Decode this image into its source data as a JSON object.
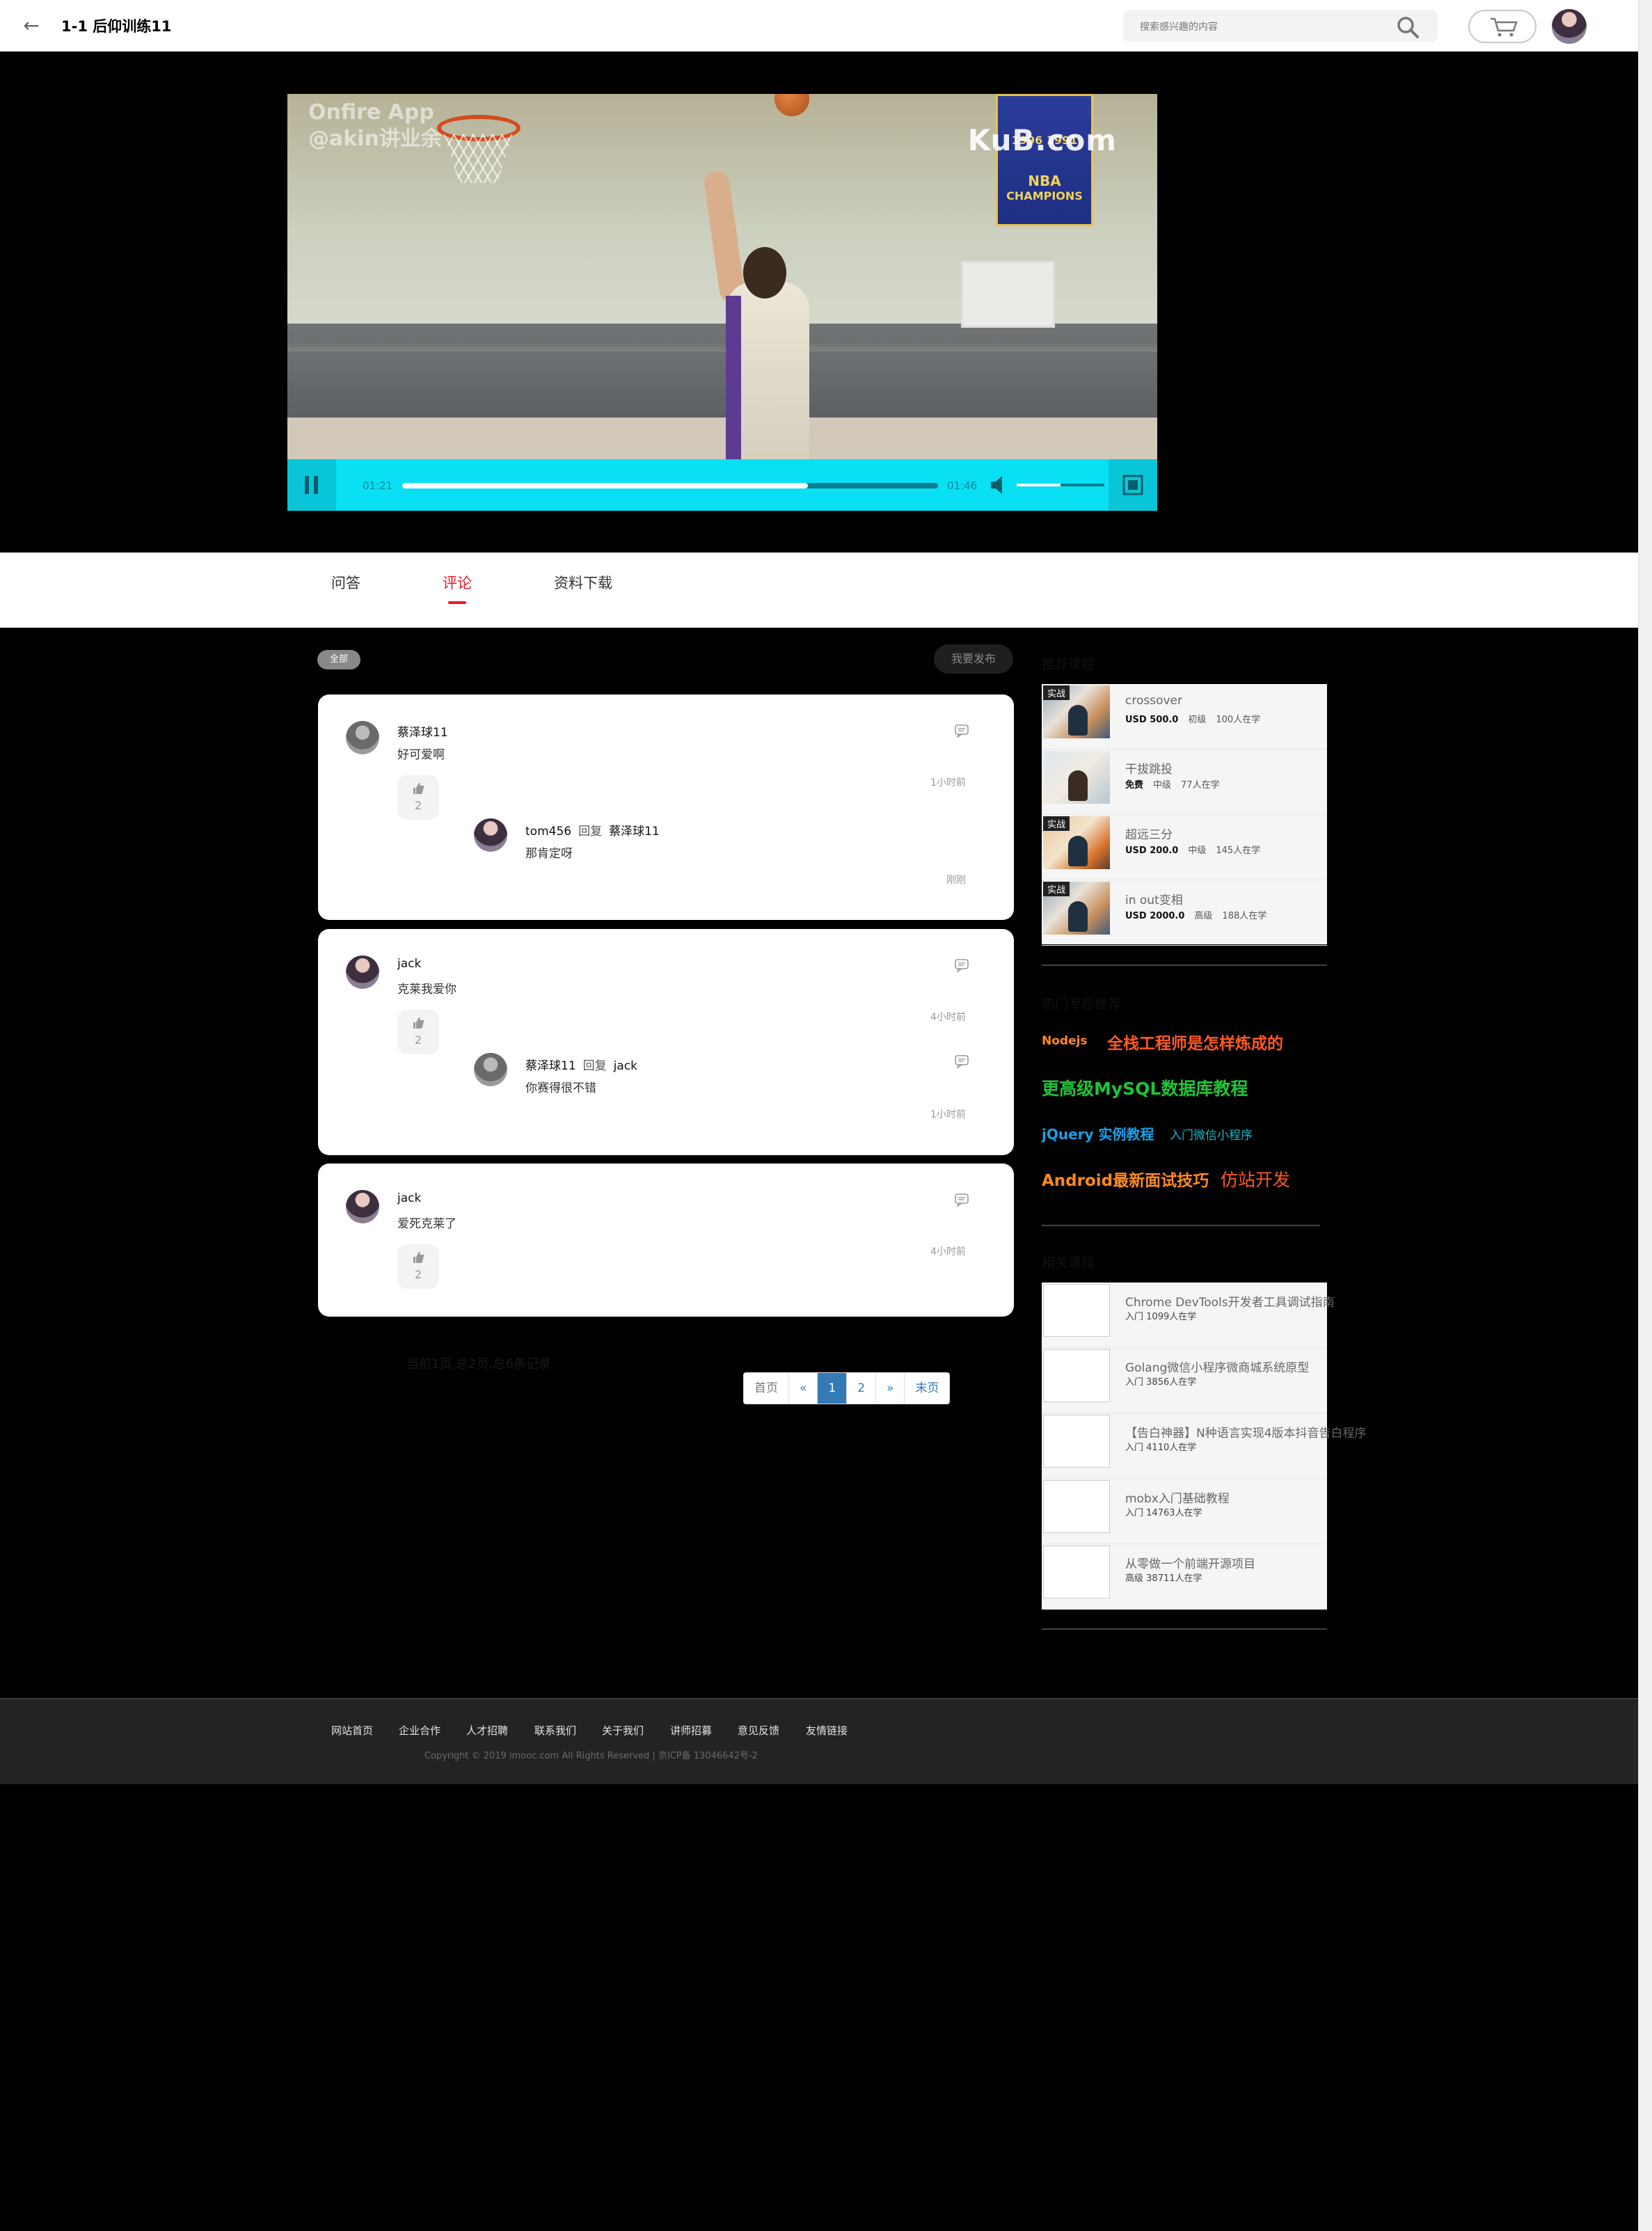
{
  "header": {
    "title": "1-1 后仰训练11",
    "search_placeholder": "搜索感兴趣的内容"
  },
  "video": {
    "watermark_left": "Onfire App\n@akin讲业余",
    "watermark_right": "KuB.com",
    "banner_lines": [
      "1996 1991",
      "NBA",
      "CHAMPIONS"
    ],
    "current_time": "01:21",
    "duration": "01:46",
    "progress_fraction": 0.757,
    "volume_fraction": 0.5
  },
  "tabs": [
    {
      "label": "问答",
      "active": false
    },
    {
      "label": "评论",
      "active": true
    },
    {
      "label": "资料下载",
      "active": false
    }
  ],
  "filter": {
    "all_label": "全部",
    "publish_label": "我要发布"
  },
  "comments": [
    {
      "user": "蔡泽球11",
      "text": "好可爱啊",
      "likes": "2",
      "time": "1小时前",
      "reply": {
        "user": "tom456",
        "reply_word": "回复",
        "to": "蔡泽球11",
        "text": "那肯定呀",
        "time": "刚刚"
      }
    },
    {
      "user": "jack",
      "text": "克莱我爱你",
      "likes": "2",
      "time": "4小时前",
      "reply": {
        "user": "蔡泽球11",
        "reply_word": "回复",
        "to": "jack",
        "text": "你赛得很不错",
        "time": "1小时前"
      }
    },
    {
      "user": "jack",
      "text": "爱死克莱了",
      "likes": "2",
      "time": "4小时前"
    }
  ],
  "pagination": {
    "info": "当前1页,总2页,总6条记录",
    "buttons": [
      "首页",
      "«",
      "1",
      "2",
      "»",
      "末页"
    ],
    "current": "1"
  },
  "sidebar": {
    "recommended_title": "推荐课程",
    "recommended": [
      {
        "tag": "实战",
        "title": "crossover",
        "price": "USD 500.0",
        "level": "初级",
        "students": "100人在学"
      },
      {
        "tag": "",
        "title": "干拔跳投",
        "price": "免费",
        "level": "中级",
        "students": "77人在学"
      },
      {
        "tag": "实战",
        "title": "超远三分",
        "price": "USD 200.0",
        "level": "中级",
        "students": "145人在学"
      },
      {
        "tag": "实战",
        "title": "in out变相",
        "price": "USD 2000.0",
        "level": "高级",
        "students": "188人在学"
      }
    ],
    "hot_title": "热门专题推荐",
    "hot_keywords": [
      {
        "text": "Nodejs",
        "color": "#ff8a1f"
      },
      {
        "text": "全栈工程师是怎样炼成的",
        "color": "#ff5a22"
      },
      {
        "text": "更高级MySQL数据库教程",
        "color": "#1fc437"
      },
      {
        "text": "jQuery 实例教程",
        "color": "#1aa0e8"
      },
      {
        "text": "入门微信小程序",
        "color": "#1ab8c8"
      },
      {
        "text": "Android最新面试技巧",
        "color": "#ff8a1f"
      },
      {
        "text": "仿站开发",
        "color": "#ff5a22"
      }
    ],
    "related_title": "相关课程",
    "related": [
      {
        "title": "Chrome DevTools开发者工具调试指南",
        "level": "入门",
        "students": "1099人在学"
      },
      {
        "title": "Golang微信小程序微商城系统原型",
        "level": "入门",
        "students": "3856人在学"
      },
      {
        "title": "【告白神器】N种语言实现4版本抖音告白程序",
        "level": "入门",
        "students": "4110人在学"
      },
      {
        "title": "mobx入门基础教程",
        "level": "入门",
        "students": "14763人在学"
      },
      {
        "title": "从零做一个前端开源项目",
        "level": "高级",
        "students": "38711人在学"
      }
    ]
  },
  "footer": {
    "links": [
      "网站首页",
      "企业合作",
      "人才招聘",
      "联系我们",
      "关于我们",
      "讲师招募",
      "意见反馈",
      "友情链接"
    ],
    "copyright": "Copyright © 2019 imooc.com All Rights Reserved | 京ICP备 13046642号-2"
  }
}
